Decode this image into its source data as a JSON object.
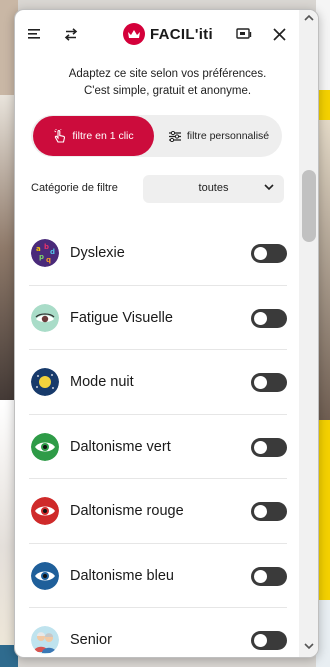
{
  "app": {
    "logo_text": "FACIL'iti"
  },
  "header": {
    "menu_icon": "hamburger-menu-icon",
    "swap_icon": "swap-arrows-icon",
    "cast_icon": "screen-cast-icon",
    "close_icon": "close-icon"
  },
  "intro": {
    "line1": "Adaptez ce site selon vos préférences.",
    "line2": "C'est simple, gratuit et anonyme."
  },
  "tabs": {
    "one_click": "filtre en 1 clic",
    "custom": "filtre personnalisé"
  },
  "category": {
    "label": "Catégorie de filtre",
    "value": "toutes"
  },
  "filters": [
    {
      "label": "Dyslexie",
      "icon": "dyslexia-letters-icon",
      "enabled": false
    },
    {
      "label": "Fatigue Visuelle",
      "icon": "tired-eye-icon",
      "enabled": false
    },
    {
      "label": "Mode nuit",
      "icon": "night-mode-moon-icon",
      "enabled": false
    },
    {
      "label": "Daltonisme vert",
      "icon": "green-eye-icon",
      "enabled": false
    },
    {
      "label": "Daltonisme rouge",
      "icon": "red-eye-icon",
      "enabled": false
    },
    {
      "label": "Daltonisme bleu",
      "icon": "blue-eye-icon",
      "enabled": false
    },
    {
      "label": "Senior",
      "icon": "senior-couple-icon",
      "enabled": false
    }
  ],
  "colors": {
    "accent": "#cc0c3c",
    "toggle_off": "#3a3a3a"
  }
}
